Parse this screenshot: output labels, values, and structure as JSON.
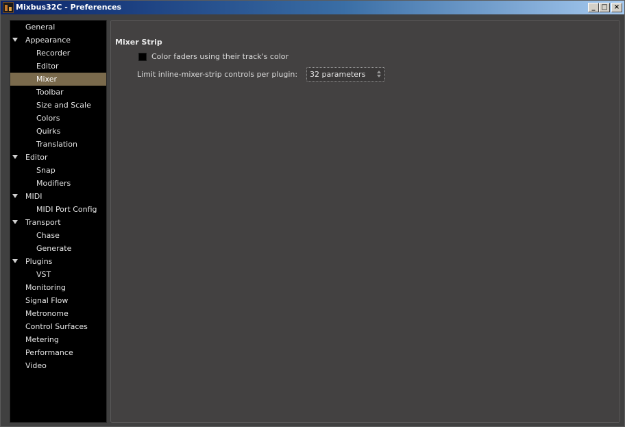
{
  "window": {
    "title": "Mixbus32C - Preferences",
    "buttons": {
      "minimize": "_",
      "maximize": "□",
      "close": "×"
    }
  },
  "sidebar": {
    "selected": "Mixer",
    "items": [
      {
        "label": "General",
        "level": 0,
        "expander": false
      },
      {
        "label": "Appearance",
        "level": 0,
        "expander": true
      },
      {
        "label": "Recorder",
        "level": 1,
        "expander": false
      },
      {
        "label": "Editor",
        "level": 1,
        "expander": false
      },
      {
        "label": "Mixer",
        "level": 1,
        "expander": false
      },
      {
        "label": "Toolbar",
        "level": 1,
        "expander": false
      },
      {
        "label": "Size and Scale",
        "level": 1,
        "expander": false
      },
      {
        "label": "Colors",
        "level": 1,
        "expander": false
      },
      {
        "label": "Quirks",
        "level": 1,
        "expander": false
      },
      {
        "label": "Translation",
        "level": 1,
        "expander": false
      },
      {
        "label": "Editor",
        "level": 0,
        "expander": true
      },
      {
        "label": "Snap",
        "level": 1,
        "expander": false
      },
      {
        "label": "Modifiers",
        "level": 1,
        "expander": false
      },
      {
        "label": "MIDI",
        "level": 0,
        "expander": true
      },
      {
        "label": "MIDI Port Config",
        "level": 1,
        "expander": false
      },
      {
        "label": "Transport",
        "level": 0,
        "expander": true
      },
      {
        "label": "Chase",
        "level": 1,
        "expander": false
      },
      {
        "label": "Generate",
        "level": 1,
        "expander": false
      },
      {
        "label": "Plugins",
        "level": 0,
        "expander": true
      },
      {
        "label": "VST",
        "level": 1,
        "expander": false
      },
      {
        "label": "Monitoring",
        "level": 0,
        "expander": false
      },
      {
        "label": "Signal Flow",
        "level": 0,
        "expander": false
      },
      {
        "label": "Metronome",
        "level": 0,
        "expander": false
      },
      {
        "label": "Control Surfaces",
        "level": 0,
        "expander": false
      },
      {
        "label": "Metering",
        "level": 0,
        "expander": false
      },
      {
        "label": "Performance",
        "level": 0,
        "expander": false
      },
      {
        "label": "Video",
        "level": 0,
        "expander": false
      }
    ]
  },
  "main": {
    "section_title": "Mixer Strip",
    "color_faders": {
      "label": "Color faders using their track's color",
      "checked": false
    },
    "limit_controls": {
      "label": "Limit inline-mixer-strip controls per plugin:",
      "value": "32 parameters"
    }
  },
  "colors": {
    "selected_row": "#7a6a4c",
    "sidebar_bg": "#000000",
    "content_bg": "#434141"
  }
}
